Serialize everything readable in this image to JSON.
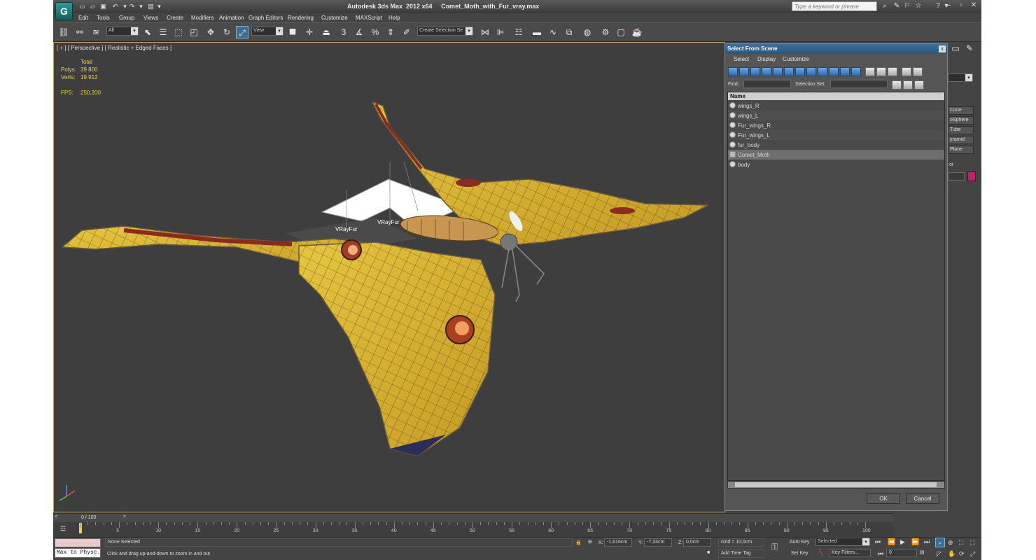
{
  "window": {
    "title": "Autodesk 3ds Max  2012 x64     Comet_Moth_with_Fur_vray.max",
    "search_placeholder": "Type a keyword or phrase"
  },
  "menu": [
    "Edit",
    "Tools",
    "Group",
    "Views",
    "Create",
    "Modifiers",
    "Animation",
    "Graph Editors",
    "Rendering",
    "Customize",
    "MAXScript",
    "Help"
  ],
  "toolbar": {
    "selection_filter": "All",
    "reference_coord": "View",
    "named_selection_set": "Create Selection Se",
    "snap_label": "3"
  },
  "viewport": {
    "label": "[ + ] [ Perspective ] [ Realistic + Edged Faces ]",
    "stats": {
      "total_label": "Total",
      "polys_label": "Polys:",
      "polys_value": "39 800",
      "verts_label": "Verts:",
      "verts_value": "19 912",
      "fps_label": "FPS:",
      "fps_value": "250,200"
    },
    "fur_labels": [
      "VRayFur",
      "VRayFur",
      "VRayFur"
    ],
    "colors": {
      "wing_yellow": "#d8b830",
      "eyespot": "#8a2b20",
      "background": "#3e3e3e"
    }
  },
  "select_dialog": {
    "title": "Select From Scene",
    "close": "x",
    "menu": [
      "Select",
      "Display",
      "Customize"
    ],
    "find_label": "Find:",
    "find_value": "",
    "selection_set_label": "Selection Set:",
    "selection_set_value": "",
    "column_header": "Name",
    "items": [
      {
        "label": "wings_R",
        "selected": false
      },
      {
        "label": "wings_L",
        "selected": false
      },
      {
        "label": "Fur_wings_R",
        "selected": false
      },
      {
        "label": "Fur_wings_L",
        "selected": false
      },
      {
        "label": "fur_body",
        "selected": false
      },
      {
        "label": "Comet_Moth",
        "selected": true
      },
      {
        "label": "body",
        "selected": false
      }
    ],
    "ok_label": "OK",
    "cancel_label": "Cancel"
  },
  "command_panel": {
    "buttons": [
      "Cone",
      "oSphere",
      "Tube",
      "yramid",
      "Plane"
    ],
    "section_label": "or",
    "color_swatch": "#c0206a"
  },
  "timeline": {
    "frame_label": "0 / 100",
    "ticks": [
      "5",
      "10",
      "15",
      "20",
      "25",
      "30",
      "35",
      "40",
      "45",
      "50",
      "55",
      "60",
      "65",
      "70",
      "75",
      "80",
      "85",
      "90",
      "95",
      "100"
    ]
  },
  "status": {
    "maxscript_label": "Max to Physc.",
    "selection": "None Selected",
    "prompt": "Click and drag up-and-down to zoom in and out",
    "x_label": "X:",
    "x_value": "-1,616cm",
    "y_label": "Y:",
    "y_value": "-7,33cm",
    "z_label": "Z:",
    "z_value": "0,0cm",
    "grid": "Grid = 10,0cm",
    "add_time_tag": "Add Time Tag",
    "auto_key": "Auto Key",
    "set_key": "Set Key",
    "key_mode": "Selected",
    "key_filters": "Key Filters...",
    "current_frame": "0"
  }
}
